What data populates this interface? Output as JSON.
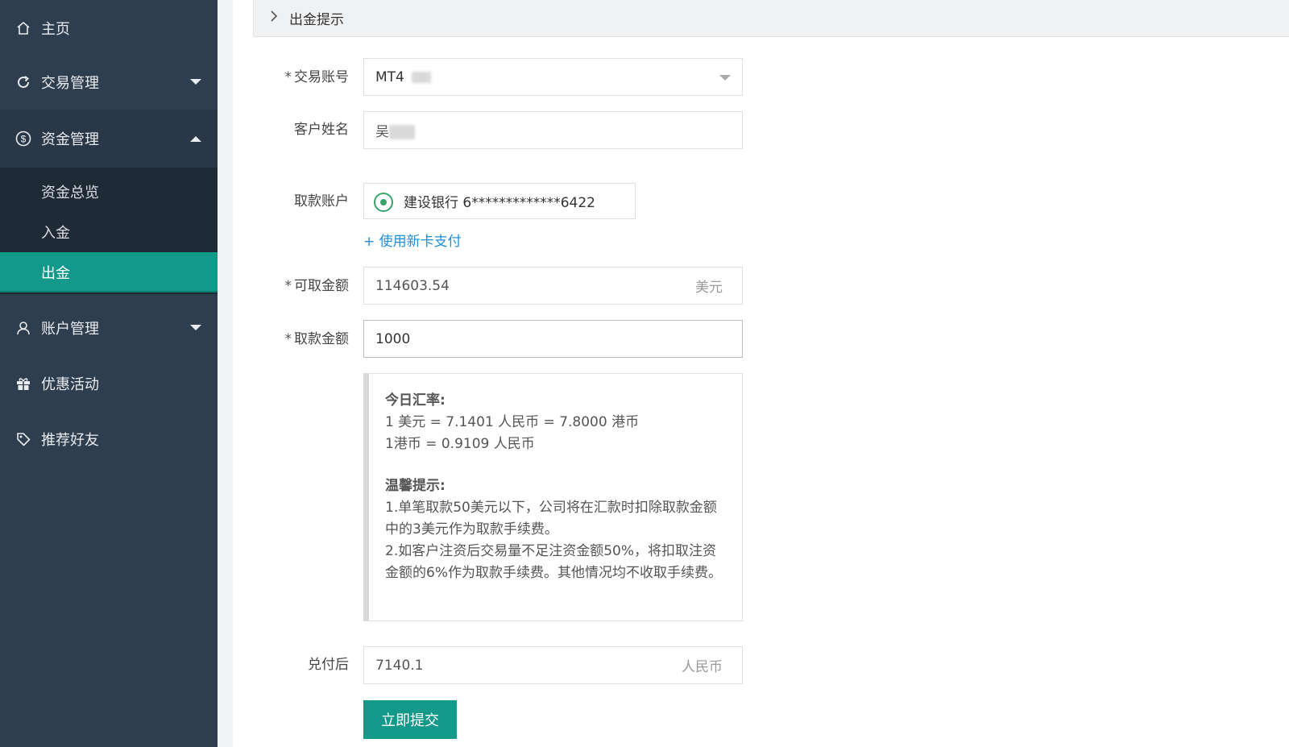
{
  "sidebar": {
    "items": [
      {
        "label": "主页",
        "icon": "home-icon"
      },
      {
        "label": "交易管理",
        "icon": "refresh-icon"
      },
      {
        "label": "资金管理",
        "icon": "dollar-circle-icon"
      },
      {
        "label": "账户管理",
        "icon": "user-icon"
      },
      {
        "label": "优惠活动",
        "icon": "gift-icon"
      },
      {
        "label": "推荐好友",
        "icon": "tag-icon"
      }
    ],
    "submenu": [
      {
        "label": "资金总览"
      },
      {
        "label": "入金"
      },
      {
        "label": "出金"
      }
    ],
    "active_submenu": "出金"
  },
  "panel": {
    "title": "出金提示"
  },
  "form": {
    "trade_account": {
      "label": "交易账号",
      "value": "MT4"
    },
    "customer_name": {
      "label": "客户姓名",
      "value": "吴"
    },
    "withdraw_account": {
      "label": "取款账户",
      "option": "建设银行 6*************6422"
    },
    "new_card_link": "+ 使用新卡支付",
    "available_amount": {
      "label": "可取金额",
      "value": "114603.54",
      "unit": "美元"
    },
    "withdraw_amount": {
      "label": "取款金额",
      "value": "1000"
    },
    "rates": {
      "title": "今日汇率:",
      "line1": "1 美元 = 7.1401 人民币 = 7.8000 港币",
      "line2": "1港币 = 0.9109 人民币"
    },
    "tips": {
      "title": "温馨提示:",
      "line1": "1.单笔取款50美元以下，公司将在汇款时扣除取款金额中的3美元作为取款手续费。",
      "line2": "2.如客户注资后交易量不足注资金额50%，将扣取注资金额的6%作为取款手续费。其他情况均不收取手续费。"
    },
    "after_exchange": {
      "label": "兑付后",
      "value": "7140.1",
      "unit": "人民币"
    },
    "submit_label": "立即提交",
    "required_mark": "*"
  },
  "colors": {
    "sidebar_bg": "#2f3e4e",
    "accent": "#13998a",
    "link": "#1f8fd8",
    "radio": "#3aa36a"
  }
}
